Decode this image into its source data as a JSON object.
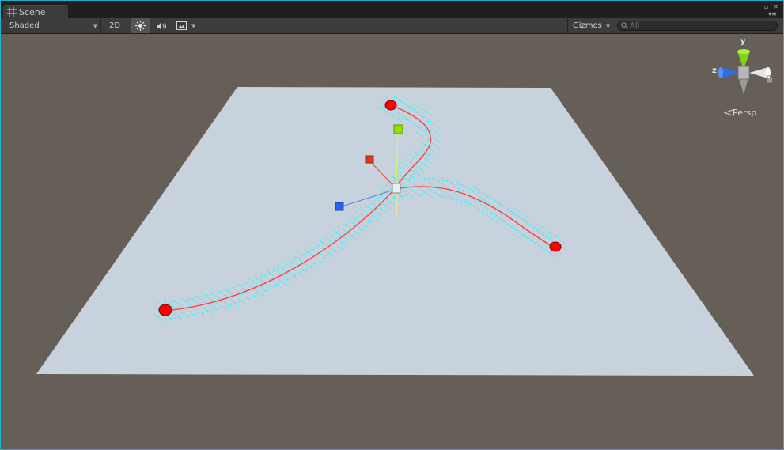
{
  "tab": {
    "title": "Scene",
    "icon": "scene-grid-icon"
  },
  "toolbar": {
    "draw_mode": "Shaded",
    "mode_2d": "2D",
    "lighting_icon": "sun-icon",
    "audio_icon": "speaker-icon",
    "effects_icon": "image-icon",
    "gizmos": "Gizmos",
    "search_placeholder": "All"
  },
  "gizmo": {
    "y_label": "y",
    "z_label": "z",
    "projection": "Persp"
  },
  "colors": {
    "viewport_bg": "#665f57",
    "plane": "#c8d2dc",
    "spline": "#ff4040",
    "wire": "#2ef0ff",
    "control_point": "#ff0000",
    "handle_green": "#8ee000",
    "handle_red": "#e03818",
    "handle_blue": "#2860f0"
  }
}
